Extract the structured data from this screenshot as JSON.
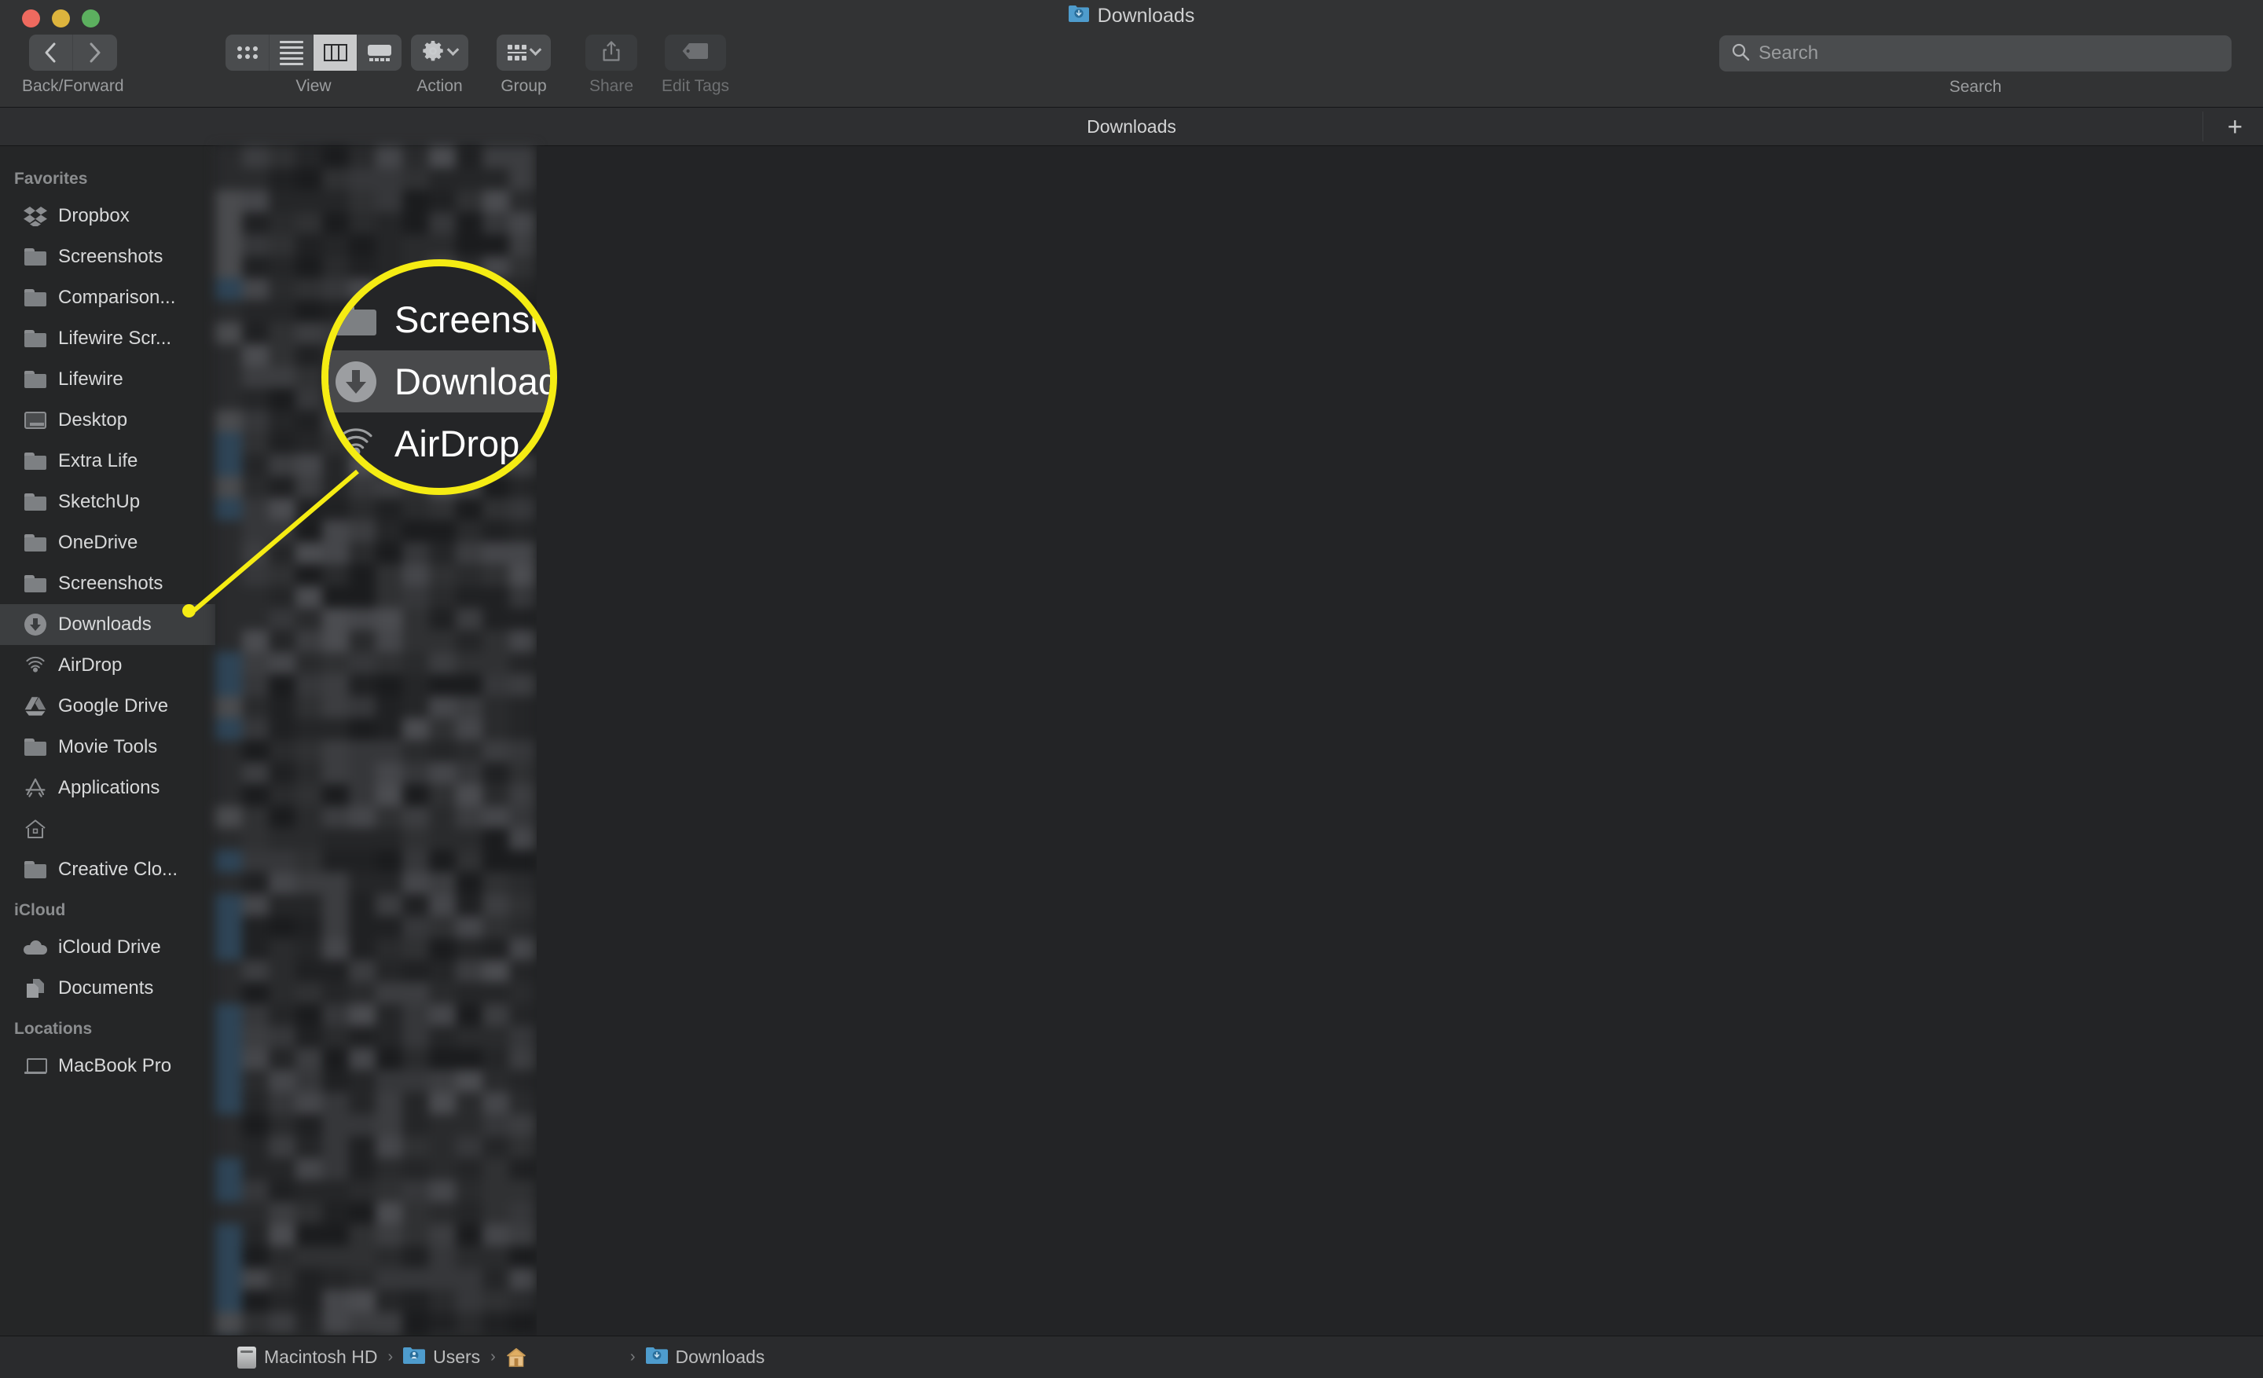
{
  "window": {
    "title": "Downloads",
    "title_icon": "blue-download-folder-icon",
    "traffic_lights": [
      "close",
      "minimize",
      "zoom"
    ]
  },
  "toolbar": {
    "back_forward": {
      "caption": "Back/Forward",
      "back_icon": "chevron-left-icon",
      "forward_icon": "chevron-right-icon"
    },
    "view": {
      "caption": "View",
      "options": [
        "icon-view",
        "list-view",
        "column-view",
        "gallery-view"
      ],
      "selected": "column-view"
    },
    "action": {
      "caption": "Action",
      "icon": "gear-icon",
      "chevron": "chevron-down-icon"
    },
    "group": {
      "caption": "Group",
      "icon": "group-icon",
      "chevron": "chevron-down-icon"
    },
    "share": {
      "caption": "Share",
      "icon": "share-icon",
      "disabled": true
    },
    "edit_tags": {
      "caption": "Edit Tags",
      "icon": "tag-icon",
      "disabled": true
    }
  },
  "search": {
    "placeholder": "Search",
    "value": "",
    "caption": "Search",
    "icon": "search-icon"
  },
  "tabbar": {
    "active_tab": "Downloads",
    "new_tab_label": "+"
  },
  "sidebar": {
    "sections": [
      {
        "header": "Favorites",
        "items": [
          {
            "label": "Dropbox",
            "icon": "dropbox-icon",
            "selected": false
          },
          {
            "label": "Screenshots",
            "icon": "folder-icon",
            "selected": false
          },
          {
            "label": "Comparison...",
            "icon": "folder-icon",
            "selected": false
          },
          {
            "label": "Lifewire Scr...",
            "icon": "folder-icon",
            "selected": false
          },
          {
            "label": "Lifewire",
            "icon": "folder-icon",
            "selected": false
          },
          {
            "label": "Desktop",
            "icon": "desktop-icon",
            "selected": false
          },
          {
            "label": "Extra Life",
            "icon": "folder-icon",
            "selected": false
          },
          {
            "label": "SketchUp",
            "icon": "folder-icon",
            "selected": false
          },
          {
            "label": "OneDrive",
            "icon": "folder-icon",
            "selected": false
          },
          {
            "label": "Screenshots",
            "icon": "folder-icon",
            "selected": false
          },
          {
            "label": "Downloads",
            "icon": "download-icon",
            "selected": true
          },
          {
            "label": "AirDrop",
            "icon": "airdrop-icon",
            "selected": false
          },
          {
            "label": "Google Drive",
            "icon": "google-drive-icon",
            "selected": false
          },
          {
            "label": "Movie Tools",
            "icon": "folder-icon",
            "selected": false
          },
          {
            "label": "Applications",
            "icon": "applications-icon",
            "selected": false
          },
          {
            "label": "",
            "icon": "home-icon",
            "selected": false
          },
          {
            "label": "Creative Clo...",
            "icon": "folder-icon",
            "selected": false
          }
        ]
      },
      {
        "header": "iCloud",
        "items": [
          {
            "label": "iCloud Drive",
            "icon": "cloud-icon",
            "selected": false
          },
          {
            "label": "Documents",
            "icon": "documents-icon",
            "selected": false
          }
        ]
      },
      {
        "header": "Locations",
        "items": [
          {
            "label": "MacBook Pro",
            "icon": "macbook-icon",
            "selected": false
          }
        ]
      }
    ]
  },
  "callout": {
    "highlight_color": "#f5ec13",
    "clipped_top_label": "...",
    "rows": [
      {
        "label": "Screensho",
        "icon": "folder-icon",
        "selected": false
      },
      {
        "label": "Downloads",
        "icon": "download-icon",
        "selected": true
      },
      {
        "label": "AirDrop",
        "icon": "airdrop-icon",
        "selected": false
      }
    ]
  },
  "pathbar": {
    "segments": [
      {
        "label": "Macintosh HD",
        "icon": "hard-drive-icon"
      },
      {
        "label": "Users",
        "icon": "users-folder-icon"
      },
      {
        "label": "",
        "icon": "home-icon"
      },
      {
        "label": "Downloads",
        "icon": "blue-download-folder-icon"
      }
    ],
    "separator": "›"
  },
  "colors": {
    "toolbar_bg": "#323334",
    "sidebar_bg": "#252627",
    "content_bg": "#222325",
    "selection_bg": "#3c3e40",
    "accent_yellow": "#f5ec13",
    "text_primary": "#d8d9da",
    "text_secondary": "#8b8d8f"
  }
}
